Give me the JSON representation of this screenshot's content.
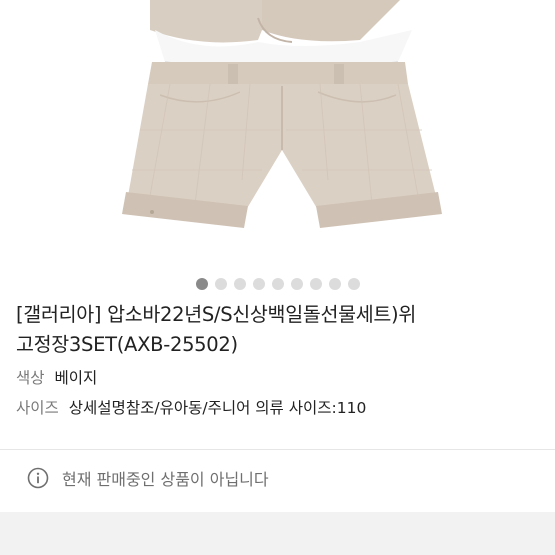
{
  "product": {
    "title_line1": "[갤러리아] 압소바22년S/S신상백일돌선물세트)위",
    "title_line2": "고정장3SET(AXB-25502)",
    "color_label": "색상",
    "color_value": "베이지",
    "size_label": "사이즈",
    "size_value": "상세설명참조/유아동/주니어 의류 사이즈:110"
  },
  "carousel": {
    "total": 9,
    "active_index": 0
  },
  "notice": {
    "icon": "info-icon",
    "text": "현재 판매중인 상품이 아닙니다"
  },
  "colors": {
    "fabric": "#d9cec2",
    "fabric_shadow": "#c9bcae",
    "shirt": "#f7f7f7",
    "dot_active": "#8a8a8a",
    "dot_inactive": "#dcdcdc",
    "muted_text": "#7a7a7a"
  }
}
